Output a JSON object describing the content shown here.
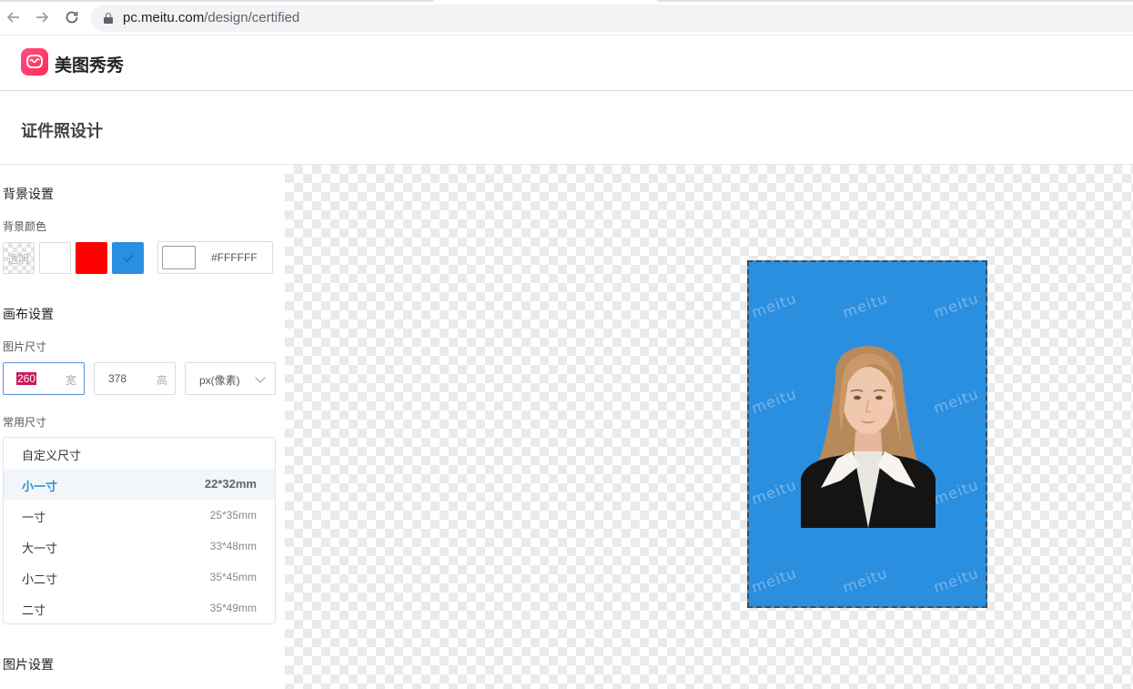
{
  "browser": {
    "url_host": "pc.meitu.com",
    "url_path": "/design/certified",
    "back_icon": "arrow-left-icon",
    "forward_icon": "arrow-right-icon",
    "reload_icon": "reload-icon"
  },
  "app": {
    "logo_text": "美图秀秀",
    "page_title": "证件照设计"
  },
  "background_settings": {
    "title": "背景设置",
    "color_label": "背景颜色",
    "transparent_label": "透明",
    "swatches": [
      "transparent",
      "#FFFFFF",
      "#FF0000",
      "#2B8FE0"
    ],
    "selected_swatch": "#2B8FE0",
    "custom_hex": "#FFFFFF"
  },
  "canvas_settings": {
    "title": "画布设置",
    "size_label": "图片尺寸",
    "width_value": "260",
    "width_unit": "宽",
    "height_value": "378",
    "height_unit": "高",
    "unit_select": "px(像素)",
    "common_sizes_label": "常用尺寸",
    "common_sizes": [
      {
        "name": "自定义尺寸",
        "dim": ""
      },
      {
        "name": "小一寸",
        "dim": "22*32mm"
      },
      {
        "name": "一寸",
        "dim": "25*35mm"
      },
      {
        "name": "大一寸",
        "dim": "33*48mm"
      },
      {
        "name": "小二寸",
        "dim": "35*45mm"
      },
      {
        "name": "二寸",
        "dim": "35*49mm"
      }
    ],
    "selected_size": "小一寸"
  },
  "image_settings": {
    "title": "图片设置"
  },
  "preview": {
    "watermark": "meitu",
    "background_color": "#2B8FE0"
  }
}
